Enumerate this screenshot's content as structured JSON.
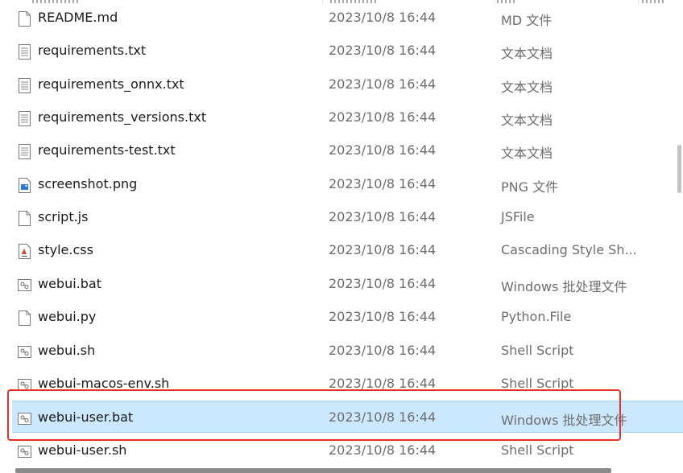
{
  "files": [
    {
      "name": "README.md",
      "date": "2023/10/8 16:44",
      "type": "MD 文件",
      "icon": "blank-file-icon"
    },
    {
      "name": "requirements.txt",
      "date": "2023/10/8 16:44",
      "type": "文本文档",
      "icon": "text-file-icon"
    },
    {
      "name": "requirements_onnx.txt",
      "date": "2023/10/8 16:44",
      "type": "文本文档",
      "icon": "text-file-icon"
    },
    {
      "name": "requirements_versions.txt",
      "date": "2023/10/8 16:44",
      "type": "文本文档",
      "icon": "text-file-icon"
    },
    {
      "name": "requirements-test.txt",
      "date": "2023/10/8 16:44",
      "type": "文本文档",
      "icon": "text-file-icon"
    },
    {
      "name": "screenshot.png",
      "date": "2023/10/8 16:44",
      "type": "PNG 文件",
      "icon": "image-file-icon"
    },
    {
      "name": "script.js",
      "date": "2023/10/8 16:44",
      "type": "JSFile",
      "icon": "blank-file-icon"
    },
    {
      "name": "style.css",
      "date": "2023/10/8 16:44",
      "type": "Cascading Style Sh...",
      "icon": "css-file-icon"
    },
    {
      "name": "webui.bat",
      "date": "2023/10/8 16:44",
      "type": "Windows 批处理文件",
      "icon": "script-file-icon"
    },
    {
      "name": "webui.py",
      "date": "2023/10/8 16:44",
      "type": "Python.File",
      "icon": "blank-file-icon"
    },
    {
      "name": "webui.sh",
      "date": "2023/10/8 16:44",
      "type": "Shell Script",
      "icon": "script-file-icon"
    },
    {
      "name": "webui-macos-env.sh",
      "date": "2023/10/8 16:44",
      "type": "Shell Script",
      "icon": "script-file-icon"
    },
    {
      "name": "webui-user.bat",
      "date": "2023/10/8 16:44",
      "type": "Windows 批处理文件",
      "icon": "script-file-icon",
      "selected": true
    },
    {
      "name": "webui-user.sh",
      "date": "2023/10/8 16:44",
      "type": "Shell Script",
      "icon": "script-file-icon"
    }
  ],
  "colors": {
    "selection": "#cce8ff",
    "highlight_box": "#e8302a",
    "secondary_text": "#6d6d6d"
  }
}
